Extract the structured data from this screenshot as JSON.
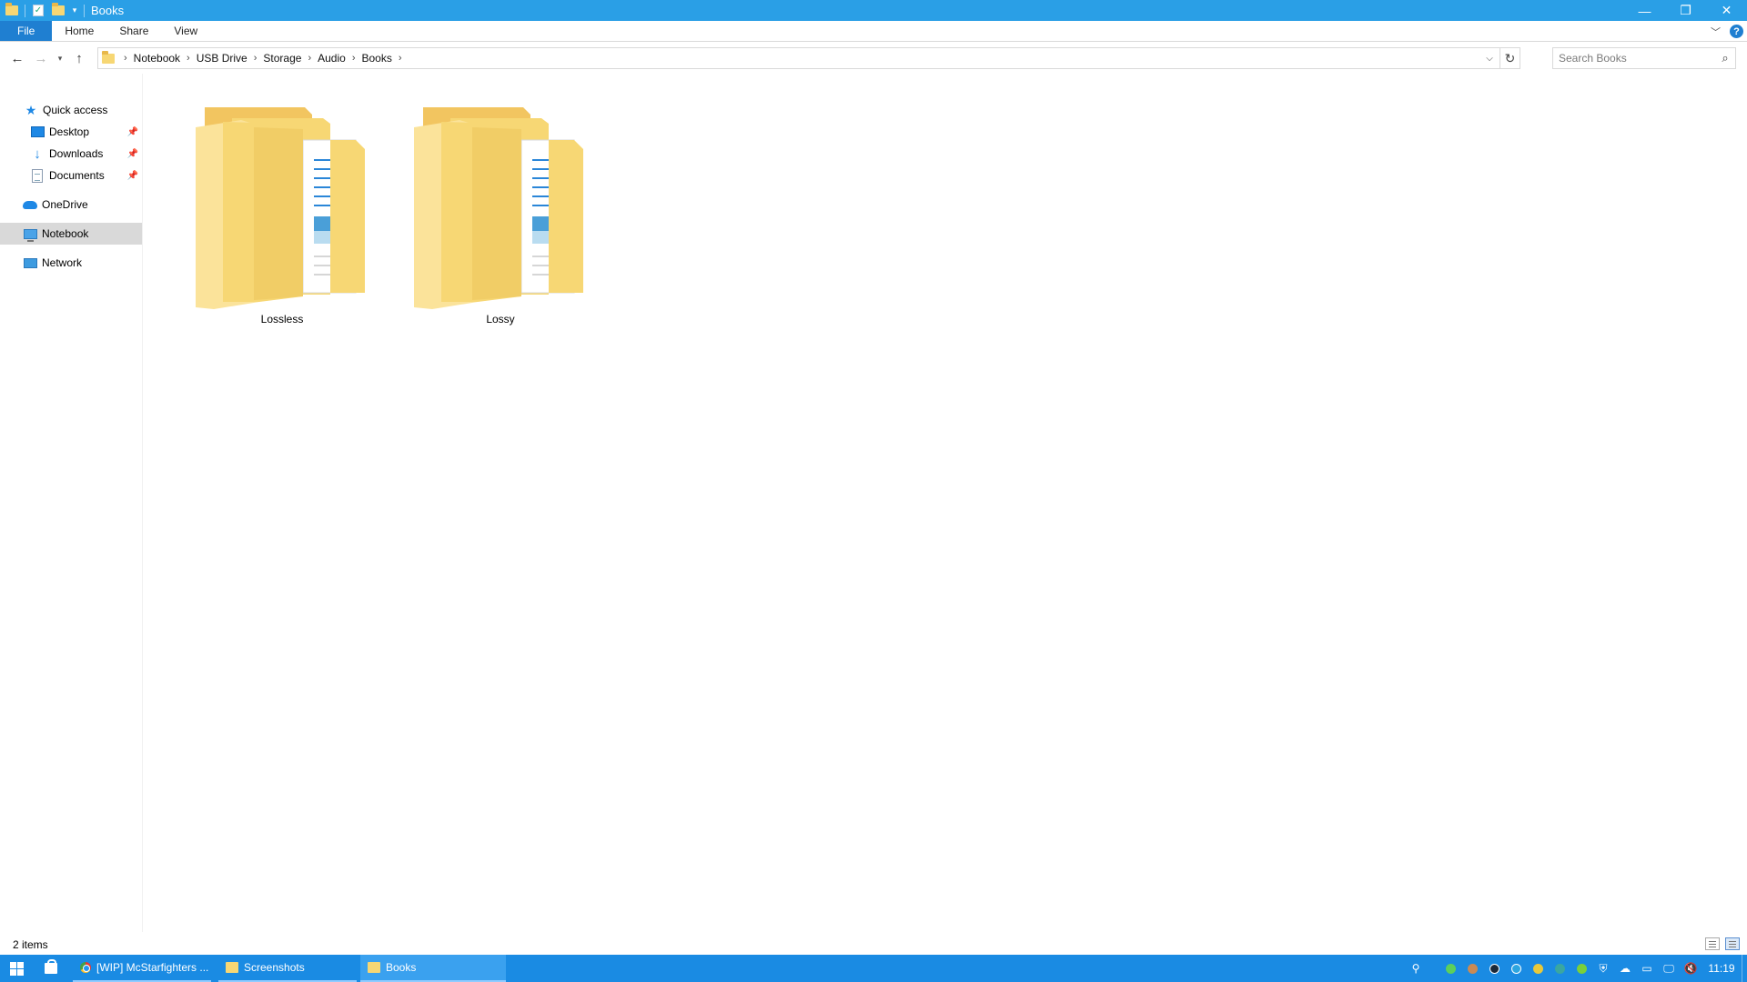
{
  "window": {
    "title": "Books",
    "controls": {
      "minimize": "—",
      "restore": "❐",
      "close": "✕"
    }
  },
  "ribbon": {
    "tabs": [
      {
        "label": "File"
      },
      {
        "label": "Home"
      },
      {
        "label": "Share"
      },
      {
        "label": "View"
      }
    ],
    "help": "?"
  },
  "address": {
    "breadcrumb": [
      "Notebook",
      "USB Drive",
      "Storage",
      "Audio",
      "Books"
    ],
    "separator": "›"
  },
  "search": {
    "placeholder": "Search Books",
    "value": ""
  },
  "navpane": {
    "quick_access": "Quick access",
    "desktop": "Desktop",
    "downloads": "Downloads",
    "documents": "Documents",
    "onedrive": "OneDrive",
    "notebook": "Notebook",
    "network": "Network"
  },
  "content": {
    "folders": [
      {
        "name": "Lossless"
      },
      {
        "name": "Lossy"
      }
    ]
  },
  "status": {
    "item_count": "2 items"
  },
  "taskbar": {
    "items": [
      {
        "label": "[WIP] McStarfighters ..."
      },
      {
        "label": "Screenshots"
      },
      {
        "label": "Books"
      }
    ],
    "clock": "11:19"
  },
  "colors": {
    "titlebar": "#2a9fe6",
    "file_tab": "#1f7fd1",
    "taskbar": "#1a8be3",
    "folder_yellow": "#f7d774",
    "selected_nav": "#d9d9d9"
  }
}
